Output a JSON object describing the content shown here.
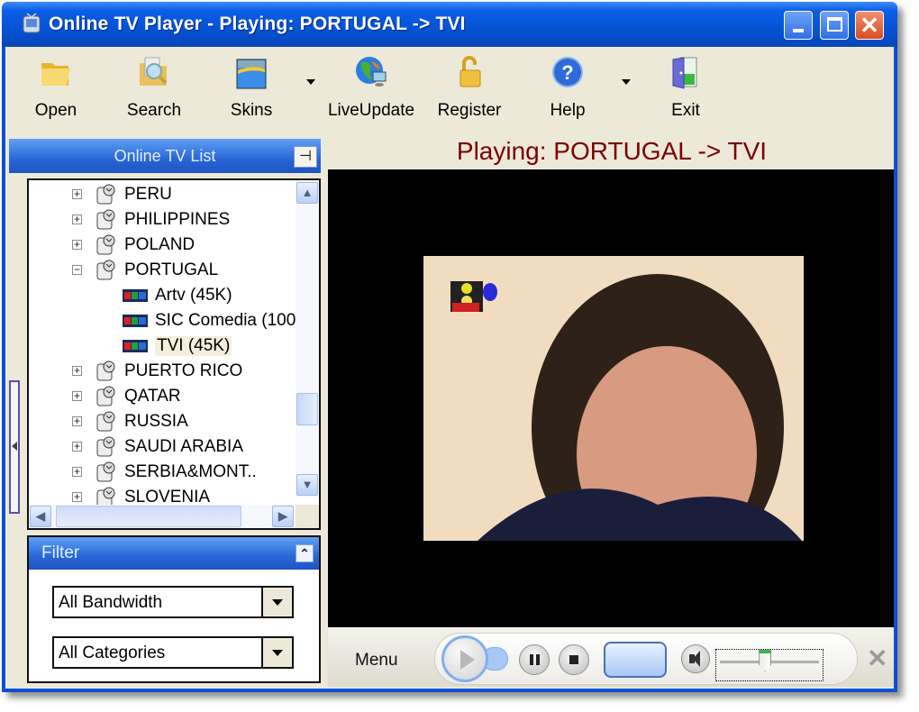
{
  "window": {
    "title": "Online TV Player - Playing: PORTUGAL -> TVI",
    "icon": "app-tv-icon",
    "controls": {
      "minimize": "minimize-icon",
      "maximize": "maximize-icon",
      "close": "close-icon",
      "close_glyph": "✕"
    }
  },
  "toolbar": {
    "items": [
      {
        "label": "Open",
        "icon": "folder-open-icon"
      },
      {
        "label": "Search",
        "icon": "search-folder-icon"
      },
      {
        "label": "Skins",
        "icon": "skins-icon",
        "has_dropdown": true
      },
      {
        "label": "LiveUpdate",
        "icon": "globe-update-icon"
      },
      {
        "label": "Register",
        "icon": "lock-icon"
      },
      {
        "label": "Help",
        "icon": "help-icon",
        "has_dropdown": true
      },
      {
        "label": "Exit",
        "icon": "exit-door-icon"
      }
    ]
  },
  "tv_list": {
    "title": "Online TV List",
    "pin_glyph": "⊣",
    "rows": [
      {
        "label": "PERU",
        "type": "country",
        "expanded": false,
        "expander": "+"
      },
      {
        "label": "PHILIPPINES",
        "type": "country",
        "expanded": false,
        "expander": "+"
      },
      {
        "label": "POLAND",
        "type": "country",
        "expanded": false,
        "expander": "+"
      },
      {
        "label": "PORTUGAL",
        "type": "country",
        "expanded": true,
        "expander": "−"
      },
      {
        "label": "Artv (45K)",
        "type": "channel"
      },
      {
        "label": "SIC Comedia (100",
        "type": "channel"
      },
      {
        "label": "TVI (45K)",
        "type": "channel",
        "selected": true
      },
      {
        "label": "PUERTO RICO",
        "type": "country",
        "expanded": false,
        "expander": "+"
      },
      {
        "label": "QATAR",
        "type": "country",
        "expanded": false,
        "expander": "+"
      },
      {
        "label": "RUSSIA",
        "type": "country",
        "expanded": false,
        "expander": "+"
      },
      {
        "label": "SAUDI ARABIA",
        "type": "country",
        "expanded": false,
        "expander": "+"
      },
      {
        "label": "SERBIA&MONT..",
        "type": "country",
        "expanded": false,
        "expander": "+"
      },
      {
        "label": "SLOVENIA",
        "type": "country",
        "expanded": false,
        "expander": "+"
      }
    ],
    "scroll": {
      "up": "▲",
      "down": "▼",
      "left": "◀",
      "right": "▶"
    }
  },
  "filter": {
    "title": "Filter",
    "collapse_glyph": "⌃",
    "bandwidth": {
      "selected": "All Bandwidth"
    },
    "categories": {
      "selected": "All Categories"
    }
  },
  "player": {
    "now_playing": "Playing: PORTUGAL -> TVI",
    "menu_label": "Menu",
    "close_glyph": "✕",
    "volume_level": 0.45
  }
}
